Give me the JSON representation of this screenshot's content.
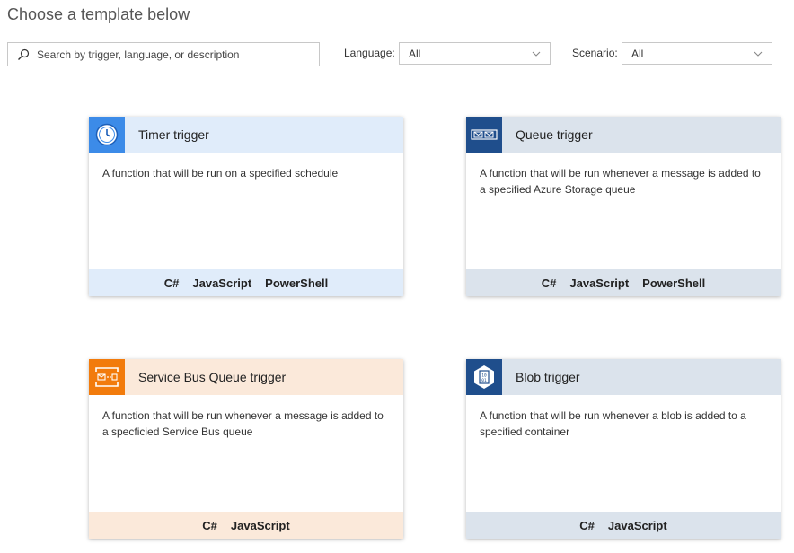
{
  "page": {
    "title": "Choose a template below"
  },
  "search": {
    "placeholder": "Search by trigger, language, or description"
  },
  "filters": {
    "language": {
      "label": "Language:",
      "value": "All"
    },
    "scenario": {
      "label": "Scenario:",
      "value": "All"
    }
  },
  "templates": [
    {
      "title": "Timer trigger",
      "description": "A function that will be run on a specified schedule",
      "icon": "clock-icon",
      "languages": [
        "C#",
        "JavaScript",
        "PowerShell"
      ]
    },
    {
      "title": "Queue trigger",
      "description": "A function that will be run whenever a message is added to a specified Azure Storage queue",
      "icon": "queue-envelope-icon",
      "languages": [
        "C#",
        "JavaScript",
        "PowerShell"
      ]
    },
    {
      "title": "Service Bus Queue trigger",
      "description": "A function that will be run whenever a message is added to a specficied Service Bus queue",
      "icon": "service-bus-icon",
      "languages": [
        "C#",
        "JavaScript"
      ]
    },
    {
      "title": "Blob trigger",
      "description": "A function that will be run whenever a blob is added to a specified container",
      "icon": "blob-icon",
      "languages": [
        "C#",
        "JavaScript"
      ]
    }
  ],
  "colors": {
    "timer_icon_bg": "#3c8be8",
    "queue_icon_bg": "#1f4e8c",
    "service_bus_icon_bg": "#f27b0c",
    "blob_icon_bg": "#1f4e8c"
  }
}
